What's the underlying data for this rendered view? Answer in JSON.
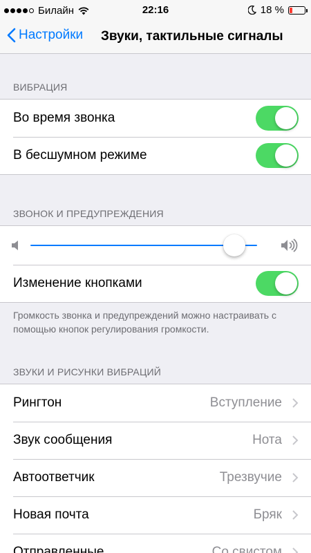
{
  "status_bar": {
    "carrier": "Билайн",
    "time": "22:16",
    "battery_percent": "18 %",
    "battery_level": 0.18,
    "icons": [
      "signal-dots-icon",
      "wifi-icon",
      "moon-icon",
      "battery-icon"
    ]
  },
  "nav": {
    "back_label": "Настройки",
    "title": "Звуки, тактильные сигналы"
  },
  "sections": {
    "vibration": {
      "header": "ВИБРАЦИЯ",
      "rows": [
        {
          "label": "Во время звонка",
          "on": true
        },
        {
          "label": "В бесшумном режиме",
          "on": true
        }
      ]
    },
    "ringer": {
      "header": "ЗВОНОК И ПРЕДУПРЕЖДЕНИЯ",
      "volume_level": 0.9,
      "change_with_buttons_label": "Изменение кнопками",
      "change_with_buttons_on": true,
      "footer": "Громкость звонка и предупреждений можно настраивать с помощью кнопок регулирования громкости."
    },
    "sounds": {
      "header": "ЗВУКИ И РИСУНКИ ВИБРАЦИЙ",
      "rows": [
        {
          "label": "Рингтон",
          "value": "Вступление"
        },
        {
          "label": "Звук сообщения",
          "value": "Нота"
        },
        {
          "label": "Автоответчик",
          "value": "Трезвучие"
        },
        {
          "label": "Новая почта",
          "value": "Бряк"
        },
        {
          "label": "Отправленные",
          "value": "Со свистом"
        }
      ]
    }
  },
  "colors": {
    "accent": "#007aff",
    "toggle_on": "#4cd964",
    "battery_low": "#ff3b30"
  }
}
